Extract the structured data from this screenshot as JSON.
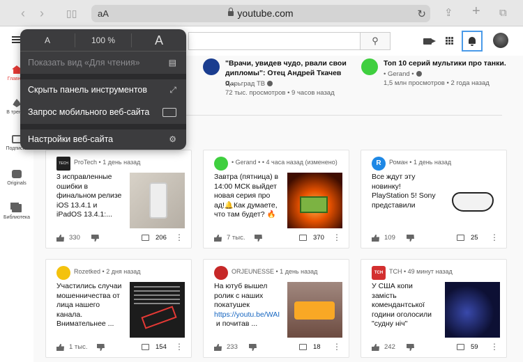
{
  "safari": {
    "aa": "aA",
    "url": "youtube.com"
  },
  "popover": {
    "zoom_small": "A",
    "zoom_value": "100 %",
    "zoom_large": "A",
    "reader_view": "Показать вид «Для чтения»",
    "hide_toolbar": "Скрыть панель инструментов",
    "request_mobile": "Запрос мобильного веб-сайта",
    "site_settings": "Настройки веб-сайта"
  },
  "sidebar": {
    "items": [
      {
        "label": "Главная"
      },
      {
        "label": "В тренде"
      },
      {
        "label": "Подписки"
      },
      {
        "label": "Originals"
      },
      {
        "label": "Библиотека"
      }
    ]
  },
  "top_videos": [
    {
      "title": "\"Врачи, увидев чудо, рвали свои дипломы\": Отец Андрей Ткачев о...",
      "channel": "Царьград ТВ",
      "meta": "72 тыс. просмотров • 9 часов назад",
      "avatar_color": "#1a3d8f"
    },
    {
      "title": "Топ 10 серий мультики про танки.",
      "channel": "• Gerand •",
      "meta": "1,5 млн просмотров • 2 года назад",
      "avatar_color": "#3fcf3f"
    }
  ],
  "posts": [
    {
      "channel": "ProTech",
      "time": "• 1 день назад",
      "text": "3 исправленные ошибки в финальном релизе iOS 13.4.1 и iPadOS 13.4.1:...",
      "likes": "330",
      "comments": "206",
      "avatar_color": "#222222",
      "avatar_text": "TECH"
    },
    {
      "channel": "• Gerand •",
      "time": "• 4 часа назад (изменено)",
      "text": "Завтра (пятница) в 14:00 МСК выйдет новая серия про ад!🔔Как думаете, что там будет? 🔥",
      "likes": "7 тыс.",
      "comments": "370",
      "avatar_color": "#3fcf3f",
      "avatar_text": ""
    },
    {
      "channel": "Роман",
      "time": "• 1 день назад",
      "text": "Все ждут эту новинку! PlayStation 5! Sony представили",
      "likes": "109",
      "comments": "25",
      "avatar_color": "#1e88e5",
      "avatar_text": "R"
    },
    {
      "channel": "Rozetked",
      "time": "• 2 дня назад",
      "text": "Участились случаи мошенничества от лица нашего канала. Внимательнее ...",
      "likes": "1 тыс.",
      "comments": "154",
      "avatar_color": "#f4c20d",
      "avatar_text": ""
    },
    {
      "channel": "ORJEUNESSE",
      "time": "• 1 день назад",
      "text": "На ютуб вышел ролик с наших покатушек",
      "link": "https://youtu.be/WAI",
      "text_after": "и почитав ...",
      "likes": "233",
      "comments": "18",
      "avatar_color": "#c62828",
      "avatar_text": ""
    },
    {
      "channel": "TCH",
      "time": "• 49 минут назад",
      "text": "У США копи замість комендантської години оголосили \"судну ніч\"",
      "likes": "242",
      "comments": "59",
      "avatar_color": "#d32f2f",
      "avatar_text": "TCH"
    }
  ]
}
